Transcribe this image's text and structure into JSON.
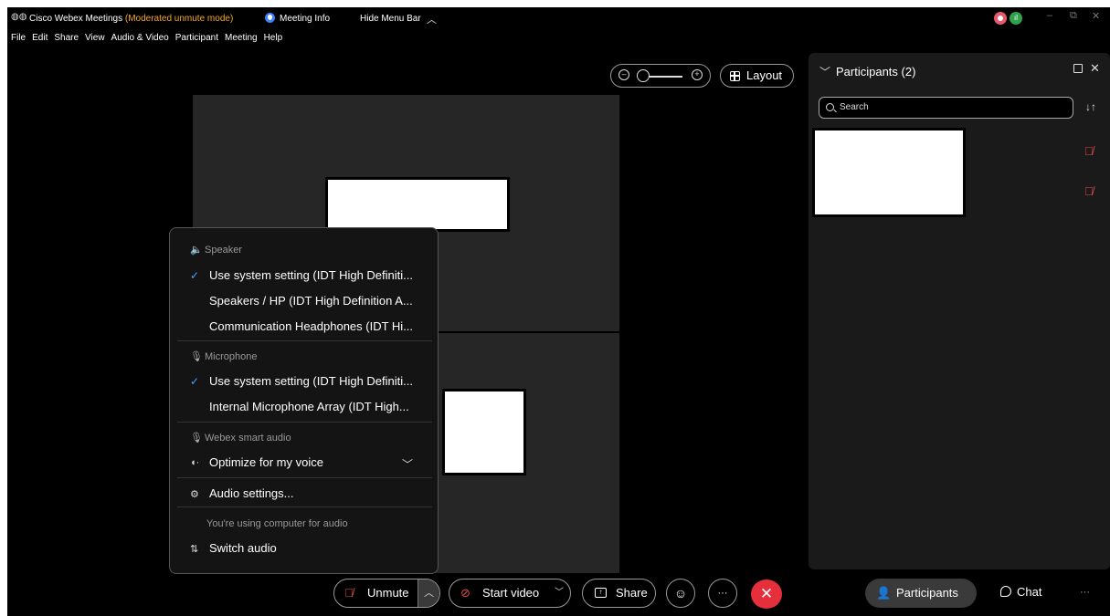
{
  "titlebar": {
    "app_title": "Cisco Webex Meetings",
    "mode": "(Moderated unmute mode)",
    "meeting_info": "Meeting Info",
    "hide_menu_bar": "Hide Menu Bar",
    "network_label": "ıl",
    "minimize": "–",
    "restore": "⧉",
    "close": "✕"
  },
  "menubar": [
    "File",
    "Edit",
    "Share",
    "View",
    "Audio & Video",
    "Participant",
    "Meeting",
    "Help"
  ],
  "stage": {
    "layout_label": "Layout"
  },
  "participants_panel": {
    "title": "Participants (2)",
    "search_placeholder": "Search",
    "rows": [
      {
        "muted": true
      },
      {
        "muted": true
      }
    ]
  },
  "audio_menu": {
    "speaker_header": "Speaker",
    "speaker_options": [
      "Use system setting (IDT High Definiti...",
      "Speakers / HP (IDT High Definition A...",
      "Communication Headphones (IDT Hi..."
    ],
    "speaker_selected_index": 0,
    "microphone_header": "Microphone",
    "microphone_options": [
      "Use system setting (IDT High Definiti...",
      "Internal Microphone Array (IDT High..."
    ],
    "microphone_selected_index": 0,
    "smart_audio_header": "Webex smart audio",
    "smart_audio_value": "Optimize for my voice",
    "audio_settings": "Audio settings...",
    "audio_note": "You're using computer for audio",
    "switch_audio": "Switch audio"
  },
  "toolbar": {
    "unmute": "Unmute",
    "start_video": "Start video",
    "share": "Share",
    "participants": "Participants",
    "chat": "Chat",
    "more": "···",
    "overflow": "···"
  },
  "colors": {
    "accent_orange": "#f5a623",
    "muted_red": "#e5484d",
    "leave_red": "#e5303b",
    "check_blue": "#4aa3ff"
  }
}
